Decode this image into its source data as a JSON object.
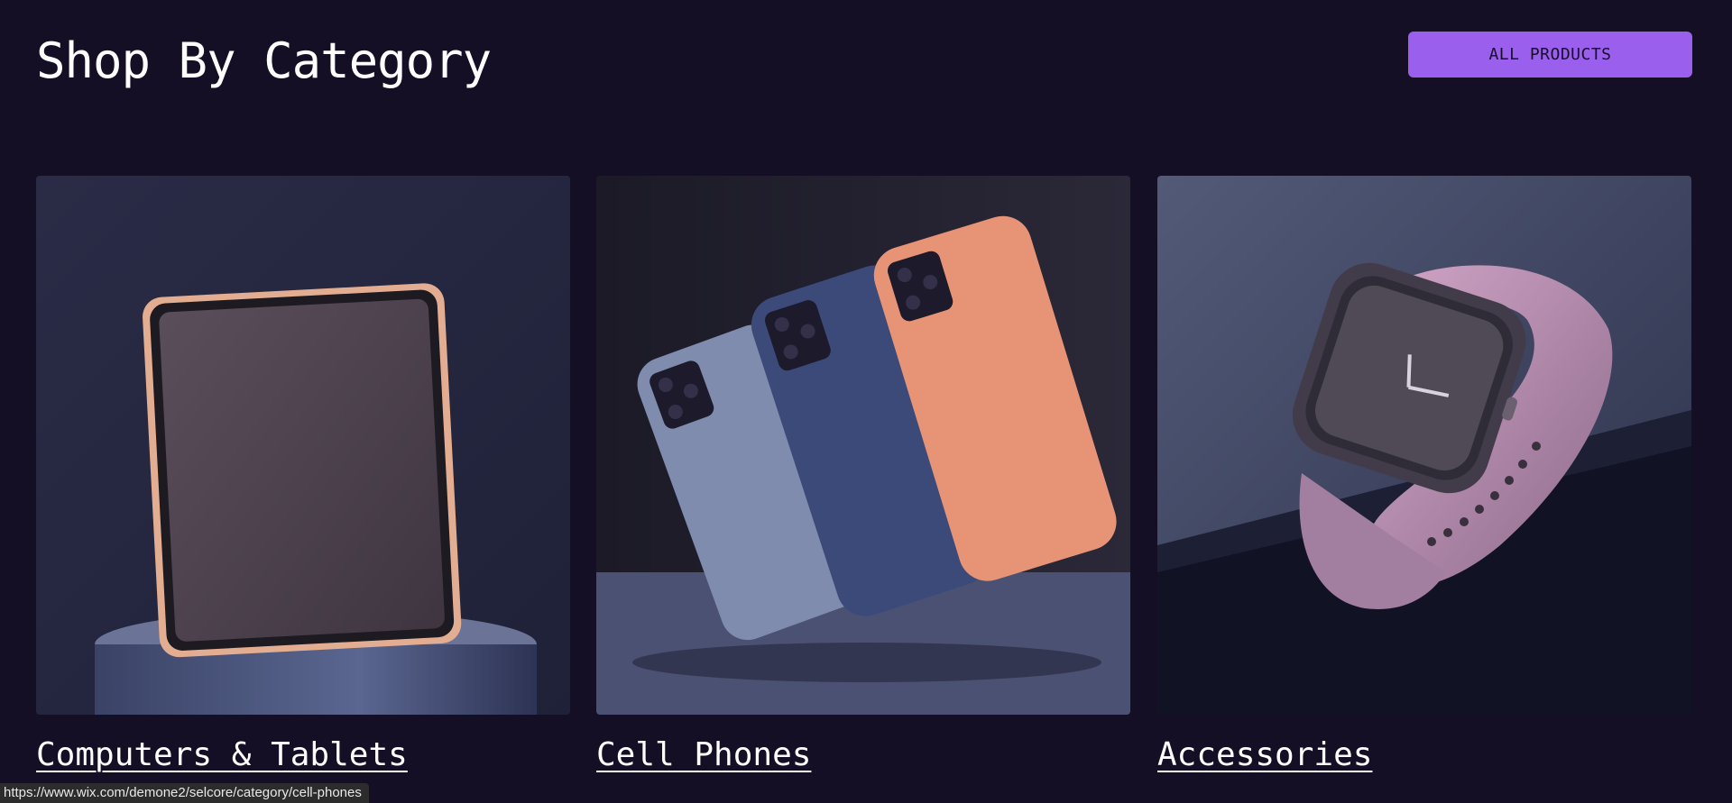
{
  "header": {
    "title": "Shop By Category",
    "all_products_label": "ALL PRODUCTS"
  },
  "categories": [
    {
      "label": "Computers & Tablets",
      "image_icon": "tablet-icon"
    },
    {
      "label": "Cell Phones",
      "image_icon": "phones-icon"
    },
    {
      "label": "Accessories",
      "image_icon": "smartwatch-icon"
    }
  ],
  "status_bar": {
    "url": "https://www.wix.com/demone2/selcore/category/cell-phones"
  },
  "colors": {
    "background": "#150f26",
    "accent": "#9b5fee",
    "text": "#ffffff"
  }
}
